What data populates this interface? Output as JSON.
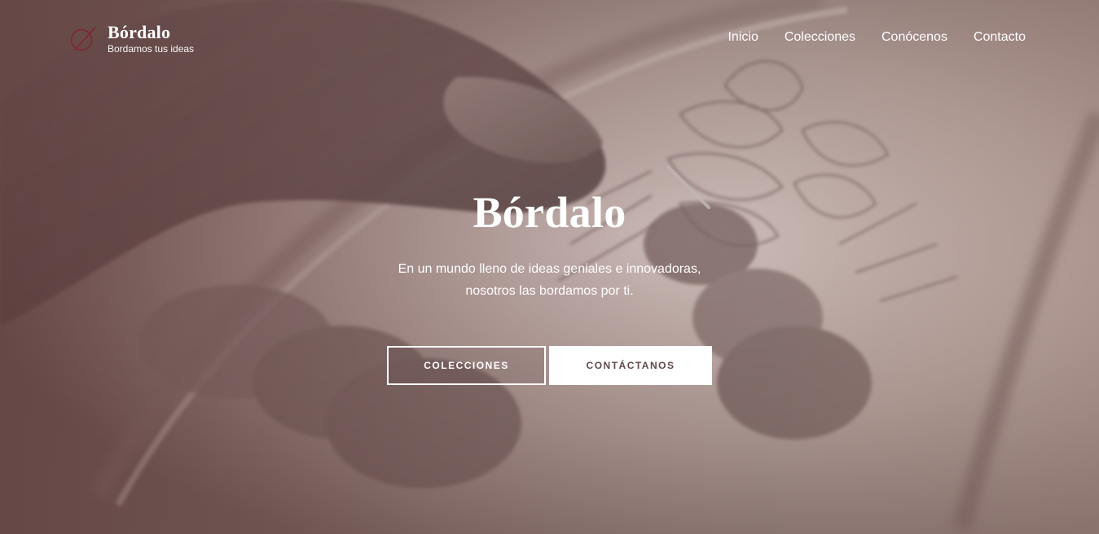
{
  "header": {
    "brand_name": "Bórdalo",
    "tagline": "Bordamos tus ideas",
    "logo_icon": "needle-thread-icon"
  },
  "nav": [
    {
      "label": "Inicio"
    },
    {
      "label": "Colecciones"
    },
    {
      "label": "Conócenos"
    },
    {
      "label": "Contacto"
    }
  ],
  "hero": {
    "title": "Bórdalo",
    "subtitle_lines": [
      "En un mundo lleno de ideas geniales e innovadoras,",
      "nosotros las bordamos por ti."
    ],
    "primary_button": "COLECCIONES",
    "secondary_button": "CONTÁCTANOS"
  },
  "colors": {
    "accent": "#7a2c34",
    "text": "#ffffff",
    "button_text_dark": "#5f4a48"
  }
}
